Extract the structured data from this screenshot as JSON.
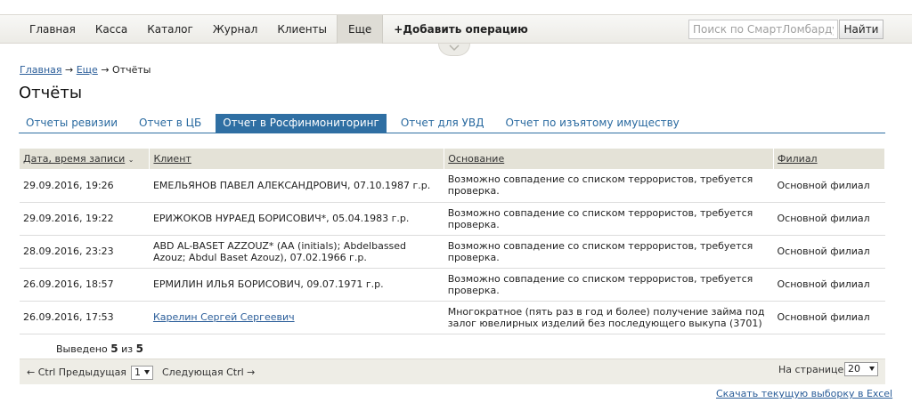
{
  "nav": {
    "items": [
      "Главная",
      "Касса",
      "Каталог",
      "Журнал",
      "Клиенты",
      "Еще"
    ],
    "active": "Еще",
    "add_operation": "+Добавить операцию",
    "search_placeholder": "Поиск по СмартЛомбарду",
    "search_button": "Найти"
  },
  "breadcrumb": {
    "home": "Главная",
    "sep1": " → ",
    "more": "Еще",
    "sep2": " → ",
    "current": "Отчёты"
  },
  "page_title": "Отчёты",
  "tabs": [
    {
      "label": "Отчеты ревизии",
      "active": false
    },
    {
      "label": "Отчет в ЦБ",
      "active": false
    },
    {
      "label": "Отчет в Росфинмониторинг",
      "active": true
    },
    {
      "label": "Отчет для УВД",
      "active": false
    },
    {
      "label": "Отчет по изъятому имуществу",
      "active": false
    }
  ],
  "table": {
    "headers": {
      "date": "Дата, время записи",
      "client": "Клиент",
      "reason": "Основание",
      "branch": "Филиал"
    },
    "rows": [
      {
        "date": "29.09.2016, 19:26",
        "client": "ЕМЕЛЬЯНОВ ПАВЕЛ АЛЕКСАНДРОВИЧ, 07.10.1987 г.р.",
        "reason": "Возможно совпадение со списком террористов, требуется проверка.",
        "branch": "Основной филиал"
      },
      {
        "date": "29.09.2016, 19:22",
        "client": "ЕРИЖОКОВ НУРАЕД БОРИСОВИЧ*, 05.04.1983 г.р.",
        "reason": "Возможно совпадение со списком террористов, требуется проверка.",
        "branch": "Основной филиал"
      },
      {
        "date": "28.09.2016, 23:23",
        "client": "ABD AL-BASET AZZOUZ* (AA (initials); Abdelbassed Azouz; Abdul Baset Azouz), 07.02.1966 г.р.",
        "reason": "Возможно совпадение со списком террористов, требуется проверка.",
        "branch": "Основной филиал"
      },
      {
        "date": "26.09.2016, 18:57",
        "client": "ЕРМИЛИН ИЛЬЯ БОРИСОВИЧ, 09.07.1971 г.р.",
        "reason": "Возможно совпадение со списком террористов, требуется проверка.",
        "branch": "Основной филиал"
      },
      {
        "date": "26.09.2016, 17:53",
        "client": "Карелин Сергей Сергеевич",
        "reason": "Многократное (пять раз в год и более) получение займа под залог ювелирных изделий без последующего выкупа (3701)",
        "branch": "Основной филиал"
      }
    ]
  },
  "summary": {
    "prefix": "Выведено ",
    "shown": "5",
    "middle": " из ",
    "total": "5"
  },
  "pager": {
    "prev": "← Ctrl Предыдущая",
    "page": "1",
    "next": "Следующая Ctrl →",
    "per_page_label": "На странице:",
    "per_page": "20"
  },
  "excel_link": "Скачать текущую выборку в Excel"
}
